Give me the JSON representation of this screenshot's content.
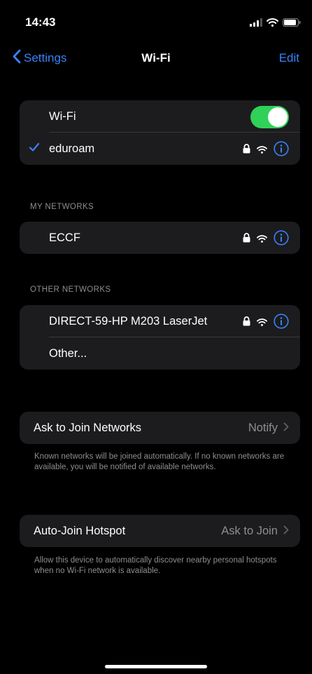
{
  "status_bar": {
    "time": "14:43"
  },
  "nav": {
    "back_label": "Settings",
    "title": "Wi-Fi",
    "edit_label": "Edit"
  },
  "wifi_group": {
    "toggle_label": "Wi-Fi",
    "toggle_on": true,
    "connected_network": "eduroam"
  },
  "my_networks": {
    "header": "MY NETWORKS",
    "items": [
      {
        "name": "ECCF"
      }
    ]
  },
  "other_networks": {
    "header": "OTHER NETWORKS",
    "items": [
      {
        "name": "DIRECT-59-HP M203 LaserJet"
      }
    ],
    "other_label": "Other..."
  },
  "ask_to_join": {
    "label": "Ask to Join Networks",
    "value": "Notify",
    "footnote": "Known networks will be joined automatically. If no known networks are available, you will be notified of available networks."
  },
  "auto_join_hotspot": {
    "label": "Auto-Join Hotspot",
    "value": "Ask to Join",
    "footnote": "Allow this device to automatically discover nearby personal hotspots when no Wi-Fi network is available."
  },
  "colors": {
    "accent": "#3a82f7",
    "toggle_on": "#30d158",
    "group_bg": "#1c1c1e",
    "secondary_text": "#8e8e93"
  },
  "icons": [
    "signal-icon",
    "wifi-icon",
    "battery-icon",
    "chevron-left-icon",
    "checkmark-icon",
    "lock-icon",
    "info-icon",
    "chevron-right-icon"
  ]
}
